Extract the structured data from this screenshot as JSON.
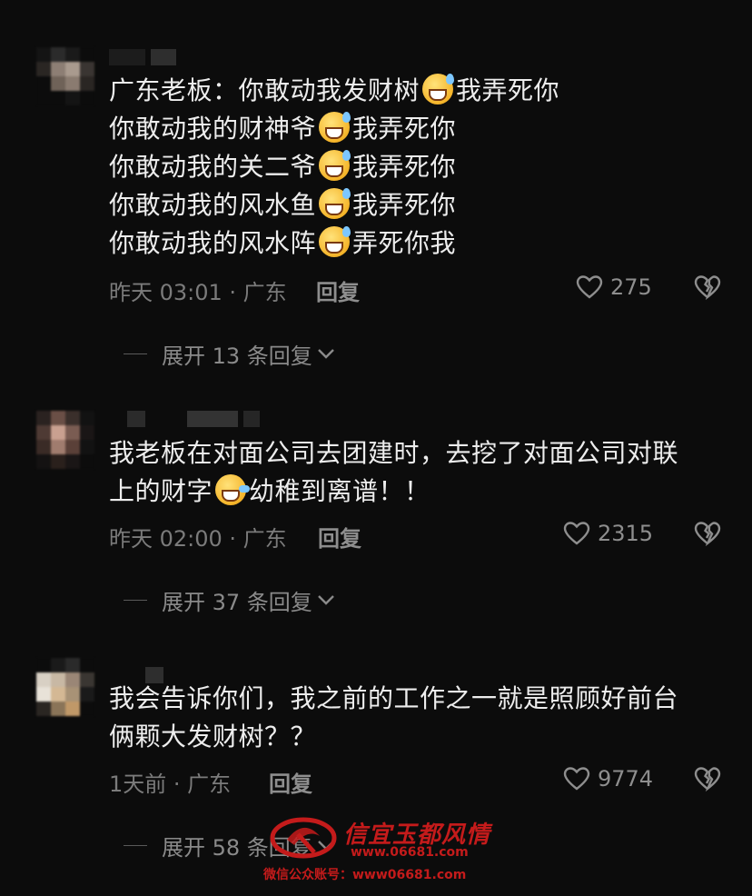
{
  "comments": [
    {
      "lines": [
        {
          "before": "广东老板：你敢动我发财树",
          "after": "我弄死你"
        },
        {
          "before": "你敢动我的财神爷",
          "after": "我弄死你"
        },
        {
          "before": "你敢动我的关二爷",
          "after": "我弄死你"
        },
        {
          "before": "你敢动我的风水鱼",
          "after": "我弄死你"
        },
        {
          "before": "你敢动我的风水阵",
          "after": "弄死你我"
        }
      ],
      "time": "昨天 03:01 · 广东",
      "reply_label": "回复",
      "likes": "275",
      "expand": "展开 13 条回复"
    },
    {
      "lines": [
        {
          "before": "我老板在对面公司去团建时，去挖了对面公司对联",
          "after": ""
        },
        {
          "before": "上的财字",
          "after": "幼稚到离谱！！"
        }
      ],
      "time": "昨天 02:00 · 广东",
      "reply_label": "回复",
      "likes": "2315",
      "expand": "展开 37 条回复"
    },
    {
      "lines": [
        {
          "before": "我会告诉你们，我之前的工作之一就是照顾好前台",
          "after": ""
        },
        {
          "before": "俩颗大发财树？？",
          "after": ""
        }
      ],
      "time": "1天前 · 广东",
      "reply_label": "回复",
      "likes": "9774",
      "expand": "展开 58 条回复"
    }
  ],
  "watermark": {
    "title": "信宜玉都风情",
    "site": "www.06681.com",
    "sub": "微信公众账号：www06681.com"
  },
  "colors": {
    "background": "#0c0c0c",
    "text": "#ededed",
    "meta": "#7b7b7b",
    "watermark": "#c41b1b"
  }
}
